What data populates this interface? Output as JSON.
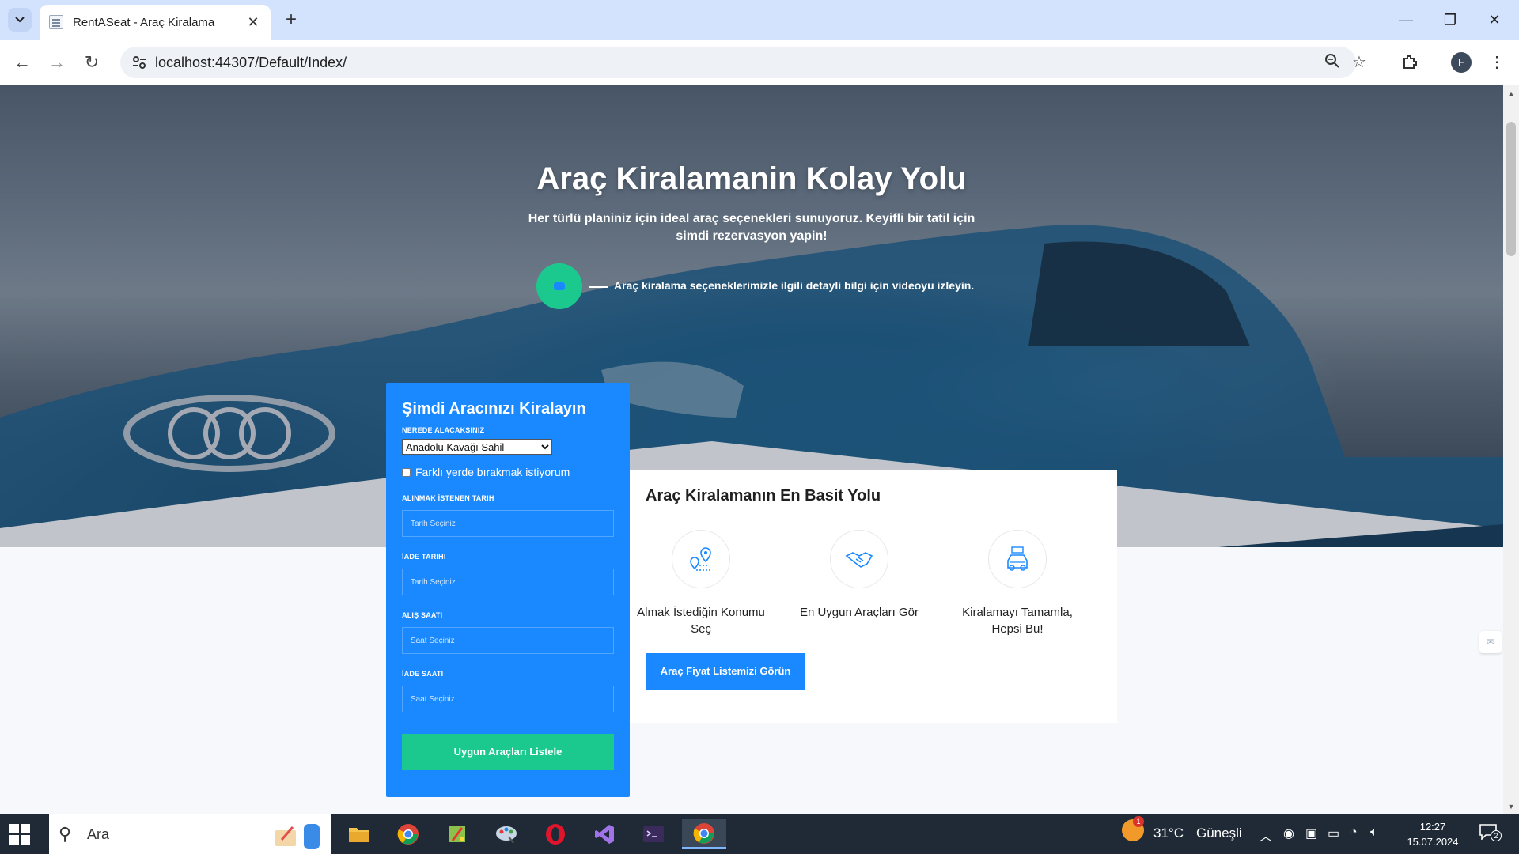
{
  "browser": {
    "tab_title": "RentASeat - Araç Kiralama",
    "url": "localhost:44307/Default/Index/",
    "profile_initial": "F"
  },
  "hero": {
    "title": "Araç Kiralamanin Kolay Yolu",
    "subtitle": "Her türlü planiniz için ideal araç seçenekleri sunuyoruz. Keyifli bir tatil için simdi rezervasyon yapin!",
    "video_text": "Araç kiralama seçeneklerimizle ilgili detayli bilgi için videoyu izleyin."
  },
  "booking": {
    "title": "Şimdi Aracınızı Kiralayın",
    "pickup_label": "NEREDE ALACAKSINIZ",
    "pickup_value": "Anadolu Kavağı Sahil",
    "dropoff_check_label": "Farklı yerde bırakmak istiyorum",
    "pickup_date_label": "ALINMAK İSTENEN TARIH",
    "pickup_date_placeholder": "Tarih Seçiniz",
    "return_date_label": "İADE TARIHI",
    "return_date_placeholder": "Tarih Seçiniz",
    "pickup_time_label": "ALIŞ SAATI",
    "pickup_time_placeholder": "Saat Seçiniz",
    "return_time_label": "İADE SAATI",
    "return_time_placeholder": "Saat Seçiniz",
    "submit_label": "Uygun Araçları Listele"
  },
  "info": {
    "title": "Araç Kiralamanın En Basit Yolu",
    "steps": [
      {
        "label": "Almak İstediğin Konumu Seç",
        "icon": "location-icon"
      },
      {
        "label": "En Uygun Araçları Gör",
        "icon": "handshake-icon"
      },
      {
        "label": "Kiralamayı Tamamla, Hepsi Bu!",
        "icon": "rent-car-icon"
      }
    ],
    "price_button": "Araç Fiyat Listemizi Görün"
  },
  "taskbar": {
    "search_text": "Ara",
    "weather_badge": "1",
    "temperature": "31°C",
    "weather": "Güneşli",
    "time": "12:27",
    "date": "15.07.2024",
    "notifications": "2"
  },
  "colors": {
    "primary": "#1a89ff",
    "accent": "#1bc98e"
  }
}
